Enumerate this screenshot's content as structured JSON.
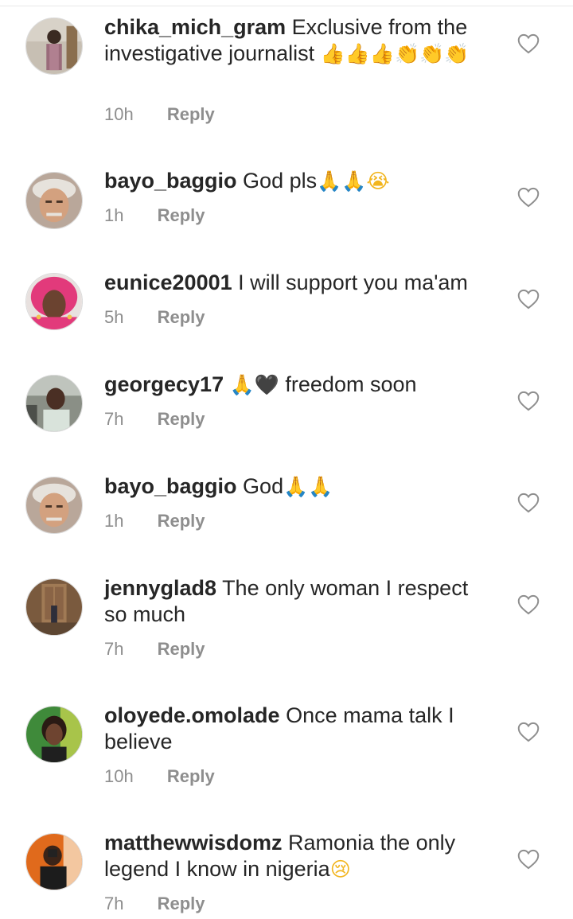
{
  "comments": [
    {
      "username": "chika_mich_gram",
      "text": "Exclusive from the investigative journalist",
      "emojis": "👍👍👍👏👏👏",
      "time": "10h",
      "reply": "Reply",
      "avatar_bg": "#c7bfb3"
    },
    {
      "username": "bayo_baggio",
      "text": "God pls",
      "emojis": "🙏🙏😭",
      "time": "1h",
      "reply": "Reply",
      "avatar_bg": "#b9a79a"
    },
    {
      "username": "eunice20001",
      "text": "I will support you ma'am",
      "emojis": "",
      "time": "5h",
      "reply": "Reply",
      "avatar_bg": "#e23a7b"
    },
    {
      "username": "georgecy17",
      "text": "freedom soon",
      "emojis": "🙏🖤",
      "time": "7h",
      "reply": "Reply",
      "avatar_bg": "#8a8f86"
    },
    {
      "username": "bayo_baggio",
      "text": "God",
      "emojis": "🙏🙏",
      "time": "1h",
      "reply": "Reply",
      "avatar_bg": "#b9a79a"
    },
    {
      "username": "jennyglad8",
      "text": "The only woman I respect so much",
      "emojis": "",
      "time": "7h",
      "reply": "Reply",
      "avatar_bg": "#7a5a3e"
    },
    {
      "username": "oloyede.omolade",
      "text": "Once mama talk I believe",
      "emojis": "",
      "time": "10h",
      "reply": "Reply",
      "avatar_bg": "#3f8a3a"
    },
    {
      "username": "matthewwisdomz",
      "text": "Ramonia the only legend I know in nigeria",
      "emojis": "😢",
      "time": "7h",
      "reply": "Reply",
      "avatar_bg": "#e06a1c"
    }
  ],
  "icons": {
    "like": "heart-outline-icon"
  },
  "colors": {
    "text": "#262626",
    "secondary": "#8e8e8e"
  }
}
